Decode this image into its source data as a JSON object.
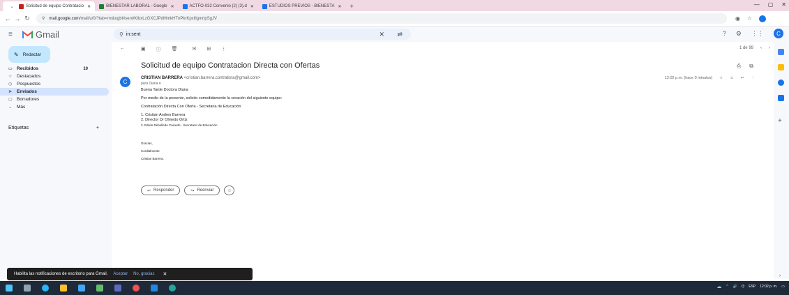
{
  "browser": {
    "tabs": [
      {
        "title": "Solicitud de equipo Contratacio",
        "color": "#c5221f",
        "active": true
      },
      {
        "title": "BIENESTAR LABORAL - Google",
        "color": "#188038",
        "active": false
      },
      {
        "title": "ACTFO-032 Convenio (2) (3).d",
        "color": "#1a73e8",
        "active": false
      },
      {
        "title": "ESTUDIOS PREVIOS - BIENESTA",
        "color": "#1a73e8",
        "active": false
      }
    ],
    "new_tab": "+",
    "url_domain": "mail.google.com",
    "url_path": "/mail/u/0/?tab=rm&ogbl#sent/KtbxLzGXCJPdMmkHTnPkrKpxlllgmrlpSgJV"
  },
  "gmail": {
    "logo_text": "Gmail",
    "search_value": "in:sent",
    "compose_label": "Redactar",
    "nav": [
      {
        "label": "Recibidos",
        "count": "10",
        "icon": "inbox-icon",
        "glyph": "▭",
        "bold": true,
        "selected": false
      },
      {
        "label": "Destacados",
        "count": "",
        "icon": "star-icon",
        "glyph": "☆",
        "bold": false,
        "selected": false
      },
      {
        "label": "Pospuestos",
        "count": "",
        "icon": "clock-icon",
        "glyph": "◷",
        "bold": false,
        "selected": false
      },
      {
        "label": "Enviados",
        "count": "",
        "icon": "send-icon",
        "glyph": "➤",
        "bold": true,
        "selected": true
      },
      {
        "label": "Borradores",
        "count": "",
        "icon": "draft-icon",
        "glyph": "▢",
        "bold": false,
        "selected": false
      },
      {
        "label": "Más",
        "count": "",
        "icon": "chevron-down-icon",
        "glyph": "⌄",
        "bold": false,
        "selected": false
      }
    ],
    "labels_title": "Etiquetas",
    "labels_add": "+",
    "pager_text": "1 de 99"
  },
  "email": {
    "subject": "Solicitud de equipo Contratacion Directa con Ofertas",
    "avatar_letter": "C",
    "sender_name": "CRISTIAN BARRERA",
    "sender_email": "<cristian.barrera.contratista@gmail.com>",
    "recipient": "para Diana ▾",
    "time": "12:02 p.m. (hace 0 minutos)",
    "body": {
      "greeting": "Buena Tarde Doctora Diana",
      "intro": "Por medio de la presente, solicito comedidamente la creación del siguiente equipo:",
      "team_name": "Contratación Directa Con Oferta - Secretaria de Educación",
      "members": [
        "1. Crisitan Andres Barrera",
        "2. Director Dr Olmedo Ortiz",
        "3. Edwin Rebolledo Caicedo - Secretario de Educación"
      ],
      "thanks": "Gracias,",
      "closing": "Cordialmente",
      "signature": "Cristian Barrera."
    },
    "reply_label": "Responder",
    "forward_label": "Reenviar"
  },
  "snackbar": {
    "message": "Habilita las notificaciones de escritorio para Gmail.",
    "accept": "Aceptar",
    "decline": "No, gracias"
  },
  "taskbar": {
    "lang": "ESP",
    "time": "12:02 p. m."
  },
  "colors": {
    "accent": "#1a73e8",
    "compose_bg": "#c2e7ff",
    "selected_nav": "#d3e3fd",
    "tabbar": "#f0d9e3"
  }
}
